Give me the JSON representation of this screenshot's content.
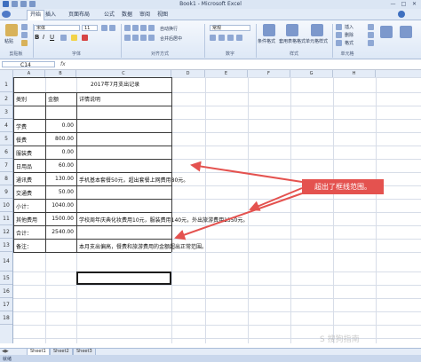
{
  "window": {
    "title": "Book1 - Microsoft Excel",
    "controls": {
      "minimize": "—",
      "maximize": "□",
      "close": "✕"
    }
  },
  "menu": {
    "tabs": [
      "开始",
      "插入",
      "页面布局",
      "公式",
      "数据",
      "审阅",
      "视图"
    ],
    "active_index": 0
  },
  "ribbon": {
    "font_name": "宋体",
    "font_size": "11",
    "number_format": "常规",
    "buttons": {
      "paste": "粘贴",
      "wrap_text": "自动换行",
      "merge_center": "合并后居中",
      "cond_format": "条件格式",
      "table_format": "套用表格格式",
      "cell_style": "单元格样式",
      "insert": "插入",
      "delete": "删除",
      "format": "格式"
    },
    "groups": [
      "剪贴板",
      "字体",
      "对齐方式",
      "数字",
      "样式",
      "单元格"
    ]
  },
  "formula_bar": {
    "name_box": "C14",
    "fx": "fx",
    "value": ""
  },
  "grid": {
    "columns": [
      "A",
      "B",
      "C",
      "D",
      "E",
      "F",
      "G",
      "H"
    ],
    "rows": [
      "1",
      "2",
      "3",
      "4",
      "5",
      "6",
      "7",
      "8",
      "9",
      "10",
      "11",
      "12",
      "13",
      "14",
      "15",
      "16",
      "17",
      "18"
    ]
  },
  "table": {
    "title": "2017年7月支出记录",
    "headers": [
      "类别",
      "金额",
      "详情说明"
    ],
    "rows": [
      {
        "category": "学费",
        "amount": "0.00",
        "detail": ""
      },
      {
        "category": "餐费",
        "amount": "800.00",
        "detail": ""
      },
      {
        "category": "服装费",
        "amount": "0.00",
        "detail": ""
      },
      {
        "category": "日用品",
        "amount": "60.00",
        "detail": ""
      },
      {
        "category": "通讯费",
        "amount": "130.00",
        "detail": "手机基本套餐50元，超出套餐上网费用80元。"
      },
      {
        "category": "交通费",
        "amount": "50.00",
        "detail": ""
      },
      {
        "category": "小计：",
        "amount": "1040.00",
        "detail": ""
      },
      {
        "category": "其他费用",
        "amount": "1500.00",
        "detail": "学校周年庆典化妆费用10元，服装费用140元，外出旅游费用1350元。"
      },
      {
        "category": "合计：",
        "amount": "2540.00",
        "detail": ""
      },
      {
        "category": "备注：",
        "amount": "",
        "detail": "本月支出偏高，餐费和旅游费用的金额超出正常范围。"
      }
    ]
  },
  "sheets": {
    "tabs": [
      "Sheet1",
      "Sheet2",
      "Sheet3"
    ],
    "active_index": 0
  },
  "status": {
    "text": "就绪"
  },
  "annotation": {
    "text": "超出了框线范围。",
    "color": "#e4524f"
  },
  "watermark": {
    "text": "S 搜狗指南"
  }
}
